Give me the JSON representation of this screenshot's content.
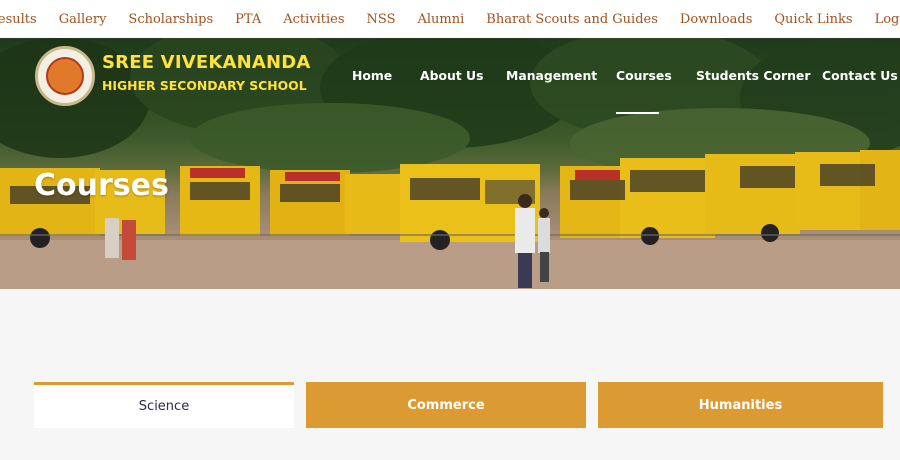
{
  "top_nav": [
    "Results",
    "Gallery",
    "Scholarships",
    "PTA",
    "Activities",
    "NSS",
    "Alumni",
    "Bharat Scouts and Guides",
    "Downloads",
    "Quick Links",
    "Login"
  ],
  "school": {
    "name_line1": "SREE VIVEKANANDA",
    "name_line2": "HIGHER SECONDARY SCHOOL"
  },
  "main_nav": [
    "Home",
    "About Us",
    "Management",
    "Courses",
    "Students Corner",
    "Contact Us"
  ],
  "hero": {
    "title": "Courses"
  },
  "tabs": [
    {
      "label": "Science",
      "active": true
    },
    {
      "label": "Commerce",
      "active": false
    },
    {
      "label": "Humanities",
      "active": false
    }
  ],
  "colors": {
    "accent": "#dc9a33",
    "topnav_text": "#a0521d",
    "logo_text": "#ffe23a"
  }
}
